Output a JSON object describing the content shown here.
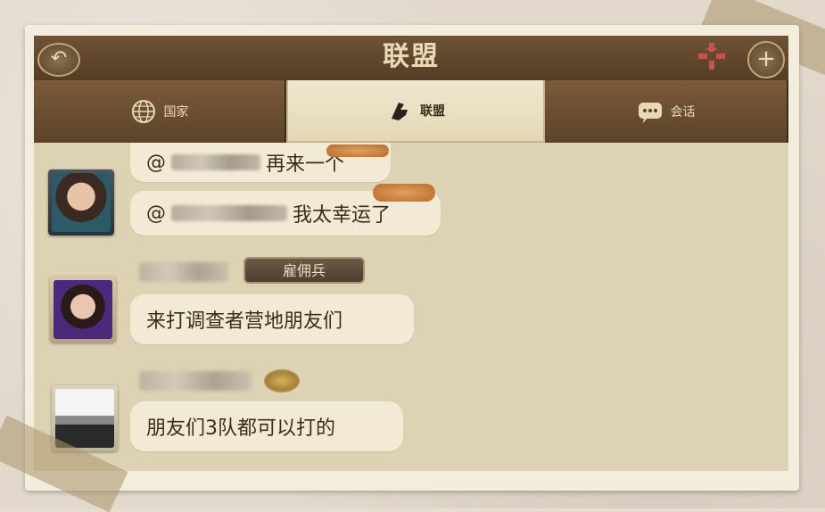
{
  "window": {
    "title": "联盟",
    "back_icon": "back-arrow-icon",
    "expand_icon": "collapse-icon",
    "add_icon": "plus-icon"
  },
  "tabs": [
    {
      "label": "国家",
      "icon": "globe-icon",
      "active": false
    },
    {
      "label": "联盟",
      "icon": "alliance-fist-icon",
      "active": true
    },
    {
      "label": "会话",
      "icon": "chat-bubble-icon",
      "active": false
    }
  ],
  "messages": [
    {
      "lines": [
        {
          "prefix": "@",
          "text": "再来一个"
        },
        {
          "prefix": "@",
          "text": "我太幸运了"
        }
      ]
    },
    {
      "rank": "雇佣兵",
      "text": "来打调查者营地朋友们"
    },
    {
      "text": "朋友们3队都可以打的"
    }
  ],
  "colors": {
    "header": "#5e4429",
    "panel_bg": "#ddd3b4",
    "bubble": "#f2ead4",
    "title_text": "#e9d9b4"
  }
}
